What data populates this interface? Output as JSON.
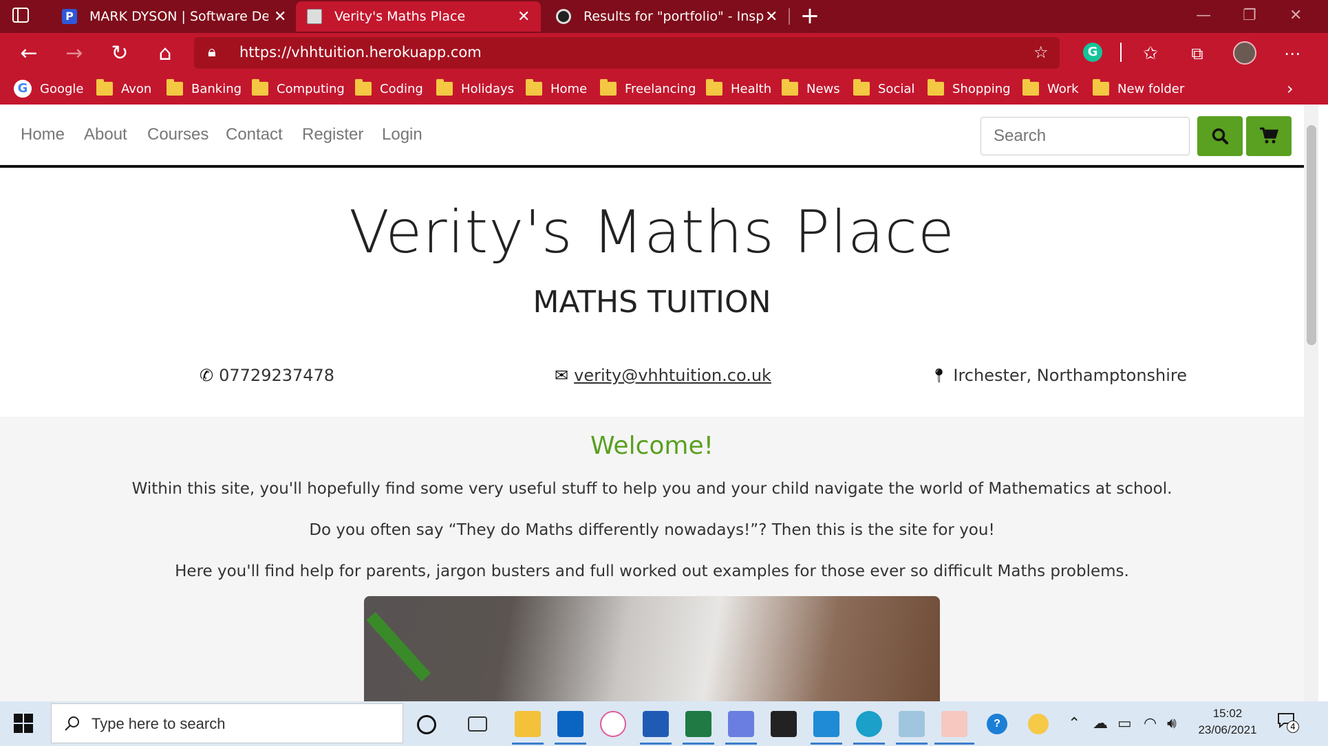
{
  "browser": {
    "tabs": [
      {
        "title": "MARK DYSON | Software Develo",
        "favicon": "p-letter-icon",
        "active": false
      },
      {
        "title": "Verity's Maths Place",
        "favicon": "tuition-logo-icon",
        "active": true
      },
      {
        "title": "Results for \"portfolio\" - Inspiro S",
        "favicon": "dark-globe-icon",
        "active": false
      }
    ],
    "url": "https://vhhtuition.herokuapp.com",
    "bookmarks": [
      "Google",
      "Avon",
      "Banking",
      "Computing",
      "Coding",
      "Holidays",
      "Home",
      "Freelancing",
      "Health",
      "News",
      "Social",
      "Shopping",
      "Work",
      "New folder"
    ],
    "colors": {
      "tabbar": "#7f0d1b",
      "toolbar": "#c3172e"
    }
  },
  "site": {
    "nav": [
      "Home",
      "About",
      "Courses",
      "Contact",
      "Register",
      "Login"
    ],
    "search_placeholder": "Search",
    "title": "Verity's Maths Place",
    "subtitle": "MATHS TUITION",
    "phone": "07729237478",
    "email": "verity@vhhtuition.co.uk",
    "location": "Irchester, Northamptonshire",
    "welcome_heading": "Welcome!",
    "paragraphs": [
      "Within this site, you'll hopefully find some very useful stuff to help you and your child navigate the world of Mathematics at school.",
      "Do you often say “They do Maths differently nowadays!”? Then this is the site for you!",
      "Here you'll find help for parents, jargon busters and full worked out examples for those ever so difficult Maths problems."
    ],
    "accent_color": "#5aa021"
  },
  "taskbar": {
    "search_placeholder": "Type here to search",
    "time": "15:02",
    "date": "23/06/2021",
    "notifications": "4"
  }
}
